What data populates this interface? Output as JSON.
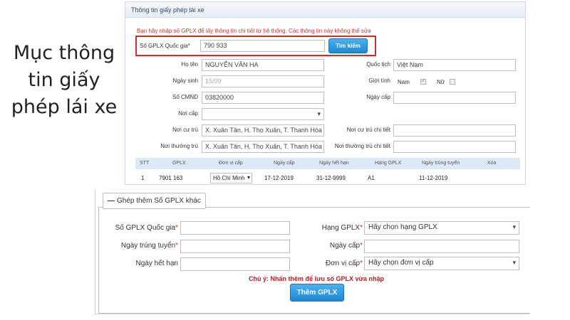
{
  "caption": {
    "lines": [
      "Mục thông",
      "tin giấy",
      "phép lái xe"
    ]
  },
  "info_panel": {
    "title": "Thông tin giấy phép lái xe",
    "notice": "Bạn hãy nhập số GPLX để lấy thông tin chi tiết từ hệ thống. Các thông tin này không thể sửa",
    "gplx_label": "Số GPLX Quốc gia*",
    "gplx_value": "790 933",
    "search_button": "Tìm kiếm",
    "name_label": "Họ tên",
    "name_value": "NGUYỄN VĂN HA",
    "nationality_label": "Quốc tịch",
    "nationality_value": "Việt Nam",
    "dob_label": "Ngày sinh",
    "dob_value": "15/09",
    "gender_label": "Giới tính",
    "gender_male": "Nam",
    "gender_female": "Nữ",
    "id_label": "Số CMND",
    "id_value": "03820000",
    "issue_date_label": "Ngày cấp",
    "issue_place_label": "Nơi cấp",
    "residence_label": "Nơi cư trú",
    "residence_value": "X. Xuân Tân, H. Thọ Xuân, T. Thanh Hóa",
    "residence_detail_label": "Nơi cư trú chi tiết",
    "permanent_label": "Nơi thường trú",
    "permanent_value": "X. Xuân Tân, H. Thọ Xuân, T. Thanh Hóa",
    "permanent_detail_label": "Nơi thường trú chi tiết",
    "table": {
      "headers": [
        "STT",
        "GPLX",
        "Đơn vị cấp",
        "Ngày cấp",
        "Ngày hết hạn",
        "Hạng GPLX",
        "Ngày trúng tuyển",
        "Xóa"
      ],
      "rows": [
        {
          "stt": "1",
          "gplx": "7901 163",
          "unit": "Hồ Chí Minh",
          "issue": "17-12-2019",
          "expiry": "31-12-9999",
          "class": "A1",
          "passed": "11-12-2019"
        }
      ]
    }
  },
  "add_panel": {
    "legend_icon": "—",
    "legend": "Ghép thêm Số GPLX khác",
    "gplx_label": "Số GPLX Quốc gia",
    "passed_date_label": "Ngày trúng tuyển",
    "expiry_label": "Ngày hết hạn",
    "class_label": "Hạng GPLX",
    "class_value": "Hãy chọn hạng GPLX",
    "issue_date_label": "Ngày cấp",
    "unit_label": "Đơn vị cấp",
    "unit_value": "Hãy chọn đơn vị cấp",
    "required_mark": "*",
    "note": "Chú ý: Nhấn thêm để lưu số GPLX vừa nhập",
    "add_button": "Thêm GPLX"
  },
  "colors": {
    "accent": "#1e88d4",
    "highlight": "#d42b2b",
    "notice": "#c0392b",
    "table_header": "#dce9f6"
  }
}
